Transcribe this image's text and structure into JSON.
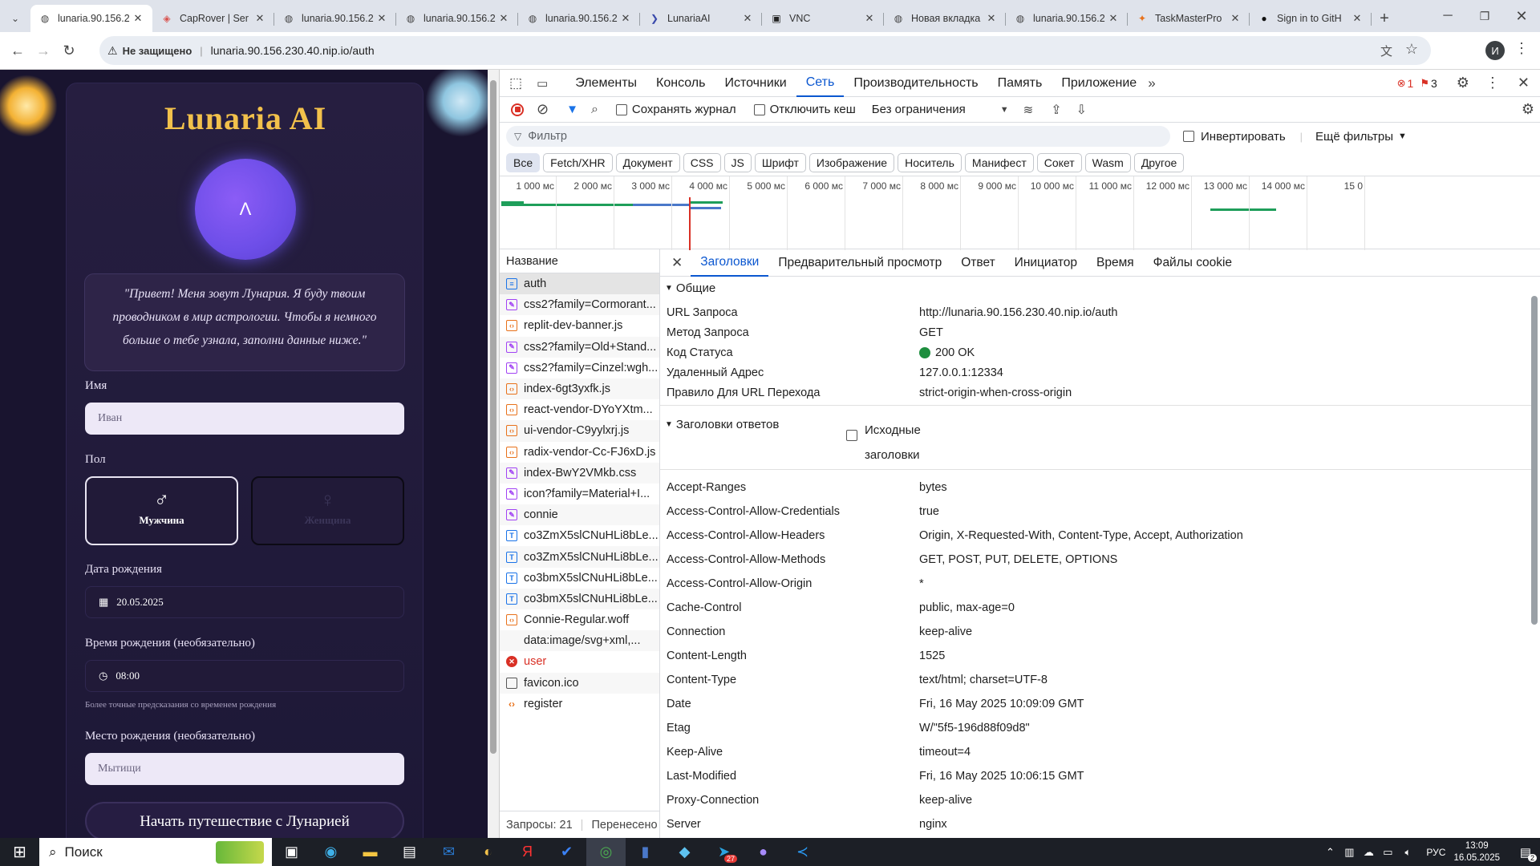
{
  "browser": {
    "tabs": [
      {
        "title": "lunaria.90.156.2",
        "icon": "globe-icon",
        "active": true
      },
      {
        "title": "CapRover | Ser",
        "icon": "caprover-icon"
      },
      {
        "title": "lunaria.90.156.2",
        "icon": "globe-icon"
      },
      {
        "title": "lunaria.90.156.2",
        "icon": "globe-icon"
      },
      {
        "title": "lunaria.90.156.2",
        "icon": "globe-icon"
      },
      {
        "title": "LunariaAI",
        "icon": "lunaria-icon"
      },
      {
        "title": "VNC",
        "icon": "vnc-icon"
      },
      {
        "title": "Новая вкладка",
        "icon": "globe-icon"
      },
      {
        "title": "lunaria.90.156.2",
        "icon": "globe-icon"
      },
      {
        "title": "TaskMasterPro",
        "icon": "taskmaster-icon"
      },
      {
        "title": "Sign in to GitH",
        "icon": "github-icon"
      }
    ],
    "not_secure": "Не защищено",
    "url": "lunaria.90.156.230.40.nip.io/auth",
    "profile_initial": "И"
  },
  "app": {
    "title": "Lunaria AI",
    "avatar_glyph": "Λ",
    "greeting": "\"Привет! Меня зовут Лунария. Я буду твоим проводником в мир астрологии. Чтобы я немного больше о тебе узнала, заполни данные ниже.\"",
    "name_label": "Имя",
    "name_value": "Иван",
    "gender_label": "Пол",
    "male_label": "Мужчина",
    "female_label": "Женщина",
    "dob_label": "Дата рождения",
    "dob_value": "20.05.2025",
    "time_label": "Время рождения (необязательно)",
    "time_value": "08:00",
    "time_hint": "Более точные предсказания со временем рождения",
    "place_label": "Место рождения (необязательно)",
    "place_value": "Мытищи",
    "submit_label": "Начать путешествие с Лунарией"
  },
  "devtools": {
    "tabs": [
      "Элементы",
      "Консоль",
      "Источники",
      "Сеть",
      "Производительность",
      "Память",
      "Приложение"
    ],
    "active_tab": "Сеть",
    "errors_count": "1",
    "issues_count": "3",
    "preserve_log": "Сохранять журнал",
    "disable_cache": "Отключить кеш",
    "throttling": "Без ограничения",
    "filter_placeholder": "Фильтр",
    "invert": "Инвертировать",
    "more_filters": "Ещё фильтры",
    "type_filters": [
      "Все",
      "Fetch/XHR",
      "Документ",
      "CSS",
      "JS",
      "Шрифт",
      "Изображение",
      "Носитель",
      "Манифест",
      "Сокет",
      "Wasm",
      "Другое"
    ],
    "timeline_ticks": [
      "1 000 мс",
      "2 000 мс",
      "3 000 мс",
      "4 000 мс",
      "5 000 мс",
      "6 000 мс",
      "7 000 мс",
      "8 000 мс",
      "9 000 мс",
      "10 000 мс",
      "11 000 мс",
      "12 000 мс",
      "13 000 мс",
      "14 000 мс",
      "15 0"
    ],
    "name_col": "Название",
    "requests": [
      {
        "name": "auth",
        "type": "doc",
        "selected": true
      },
      {
        "name": "css2?family=Cormorant...",
        "type": "css"
      },
      {
        "name": "replit-dev-banner.js",
        "type": "js"
      },
      {
        "name": "css2?family=Old+Stand...",
        "type": "css"
      },
      {
        "name": "css2?family=Cinzel:wgh...",
        "type": "css"
      },
      {
        "name": "index-6gt3yxfk.js",
        "type": "js"
      },
      {
        "name": "react-vendor-DYoYXtm...",
        "type": "js"
      },
      {
        "name": "ui-vendor-C9yylxrj.js",
        "type": "js"
      },
      {
        "name": "radix-vendor-Cc-FJ6xD.js",
        "type": "js"
      },
      {
        "name": "index-BwY2VMkb.css",
        "type": "css"
      },
      {
        "name": "icon?family=Material+I...",
        "type": "css"
      },
      {
        "name": "connie",
        "type": "css"
      },
      {
        "name": "co3ZmX5slCNuHLi8bLe...",
        "type": "font"
      },
      {
        "name": "co3ZmX5slCNuHLi8bLe...",
        "type": "font"
      },
      {
        "name": "co3bmX5slCNuHLi8bLe...",
        "type": "font"
      },
      {
        "name": "co3bmX5slCNuHLi8bLe...",
        "type": "font"
      },
      {
        "name": "Connie-Regular.woff",
        "type": "js"
      },
      {
        "name": "data:image/svg+xml,...",
        "type": "none"
      },
      {
        "name": "user",
        "type": "error"
      },
      {
        "name": "favicon.ico",
        "type": "other"
      },
      {
        "name": "register",
        "type": "fetch"
      }
    ],
    "status_requests": "Запросы: 21",
    "status_transferred": "Перенесено",
    "detail_tabs": [
      "Заголовки",
      "Предварительный просмотр",
      "Ответ",
      "Инициатор",
      "Время",
      "Файлы cookie"
    ],
    "general_title": "Общие",
    "general": [
      {
        "k": "URL Запроса",
        "v": "http://lunaria.90.156.230.40.nip.io/auth"
      },
      {
        "k": "Метод Запроса",
        "v": "GET"
      },
      {
        "k": "Код Статуса",
        "v": "200 OK"
      },
      {
        "k": "Удаленный Адрес",
        "v": "127.0.0.1:12334"
      },
      {
        "k": "Правило Для URL Перехода",
        "v": "strict-origin-when-cross-origin"
      }
    ],
    "response_headers_title": "Заголовки ответов",
    "raw_headers_1": "Исходные",
    "raw_headers_2": "заголовки",
    "response_headers": [
      {
        "k": "Accept-Ranges",
        "v": "bytes"
      },
      {
        "k": "Access-Control-Allow-Credentials",
        "v": "true"
      },
      {
        "k": "Access-Control-Allow-Headers",
        "v": "Origin, X-Requested-With, Content-Type, Accept, Authorization"
      },
      {
        "k": "Access-Control-Allow-Methods",
        "v": "GET, POST, PUT, DELETE, OPTIONS"
      },
      {
        "k": "Access-Control-Allow-Origin",
        "v": "*"
      },
      {
        "k": "Cache-Control",
        "v": "public, max-age=0"
      },
      {
        "k": "Connection",
        "v": "keep-alive"
      },
      {
        "k": "Content-Length",
        "v": "1525"
      },
      {
        "k": "Content-Type",
        "v": "text/html; charset=UTF-8"
      },
      {
        "k": "Date",
        "v": "Fri, 16 May 2025 10:09:09 GMT"
      },
      {
        "k": "Etag",
        "v": "W/\"5f5-196d88f09d8\""
      },
      {
        "k": "Keep-Alive",
        "v": "timeout=4"
      },
      {
        "k": "Last-Modified",
        "v": "Fri, 16 May 2025 10:06:15 GMT"
      },
      {
        "k": "Proxy-Connection",
        "v": "keep-alive"
      },
      {
        "k": "Server",
        "v": "nginx"
      }
    ]
  },
  "taskbar": {
    "search_placeholder": "Поиск",
    "language": "РУС",
    "time": "13:09",
    "date": "16.05.2025",
    "notification_count": "2",
    "telegram_badge": "27"
  }
}
